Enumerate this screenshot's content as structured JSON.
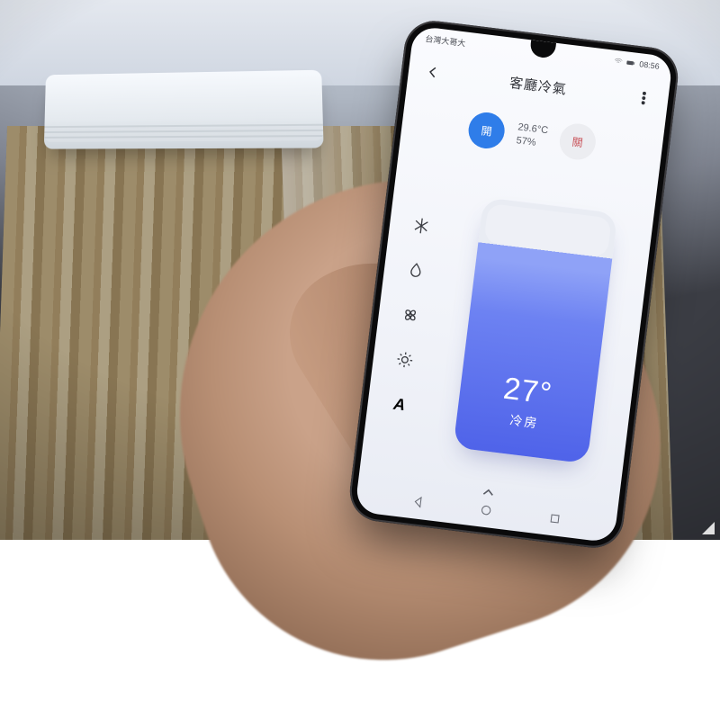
{
  "statusbar": {
    "carrier": "台灣大哥大",
    "time": "08:56"
  },
  "header": {
    "title": "客廳冷氣"
  },
  "power": {
    "on_label": "開",
    "off_label": "關"
  },
  "readings": {
    "temp": "29.6°C",
    "humidity": "57%"
  },
  "modes": {
    "cool": "cool",
    "dry": "dry",
    "fan": "fan",
    "heat": "heat",
    "auto_label": "A"
  },
  "setpoint": {
    "value": "27°",
    "mode_label": "冷房"
  }
}
